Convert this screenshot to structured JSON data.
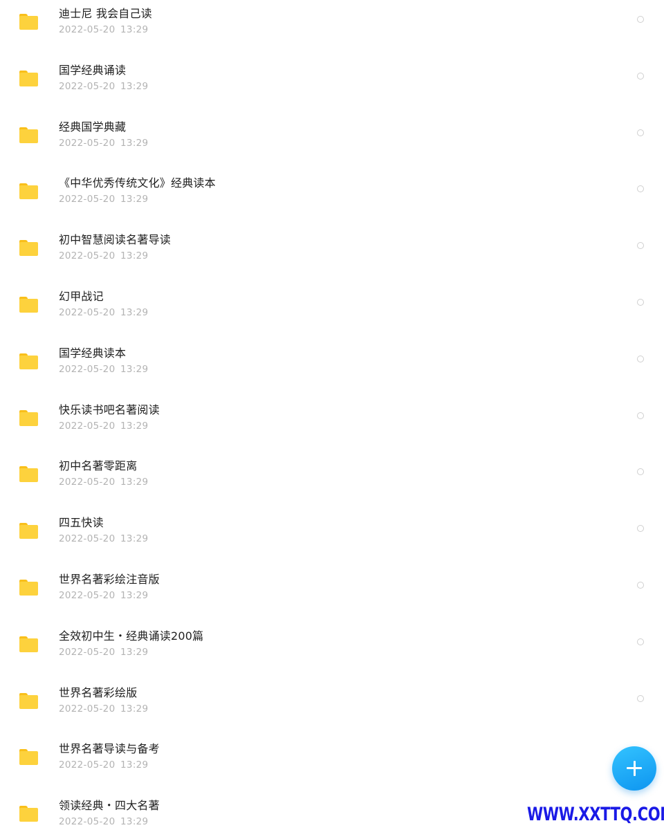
{
  "files": [
    {
      "name": "迪士尼 我会自己读",
      "time": "2022-05-20  13:29"
    },
    {
      "name": "国学经典诵读",
      "time": "2022-05-20  13:29"
    },
    {
      "name": "经典国学典藏",
      "time": "2022-05-20  13:29"
    },
    {
      "name": "《中华优秀传统文化》经典读本",
      "time": "2022-05-20  13:29"
    },
    {
      "name": "初中智慧阅读名著导读",
      "time": "2022-05-20  13:29"
    },
    {
      "name": "幻甲战记",
      "time": "2022-05-20  13:29"
    },
    {
      "name": "国学经典读本",
      "time": "2022-05-20  13:29"
    },
    {
      "name": "快乐读书吧名著阅读",
      "time": "2022-05-20  13:29"
    },
    {
      "name": "初中名著零距离",
      "time": "2022-05-20  13:29"
    },
    {
      "name": "四五快读",
      "time": "2022-05-20  13:29"
    },
    {
      "name": "世界名著彩绘注音版",
      "time": "2022-05-20  13:29"
    },
    {
      "name": "全效初中生・经典诵读200篇",
      "time": "2022-05-20  13:29"
    },
    {
      "name": "世界名著彩绘版",
      "time": "2022-05-20  13:29"
    },
    {
      "name": "世界名著导读与备考",
      "time": "2022-05-20  13:29"
    },
    {
      "name": "领读经典・四大名著",
      "time": "2022-05-20  13:29"
    }
  ],
  "fab": {
    "icon": "plus-icon"
  },
  "watermark": "WWW.XXTTQ.COM",
  "colors": {
    "folder": "#fdd23d",
    "fab": "#1aa8f5",
    "watermark": "#1a1ae6"
  }
}
